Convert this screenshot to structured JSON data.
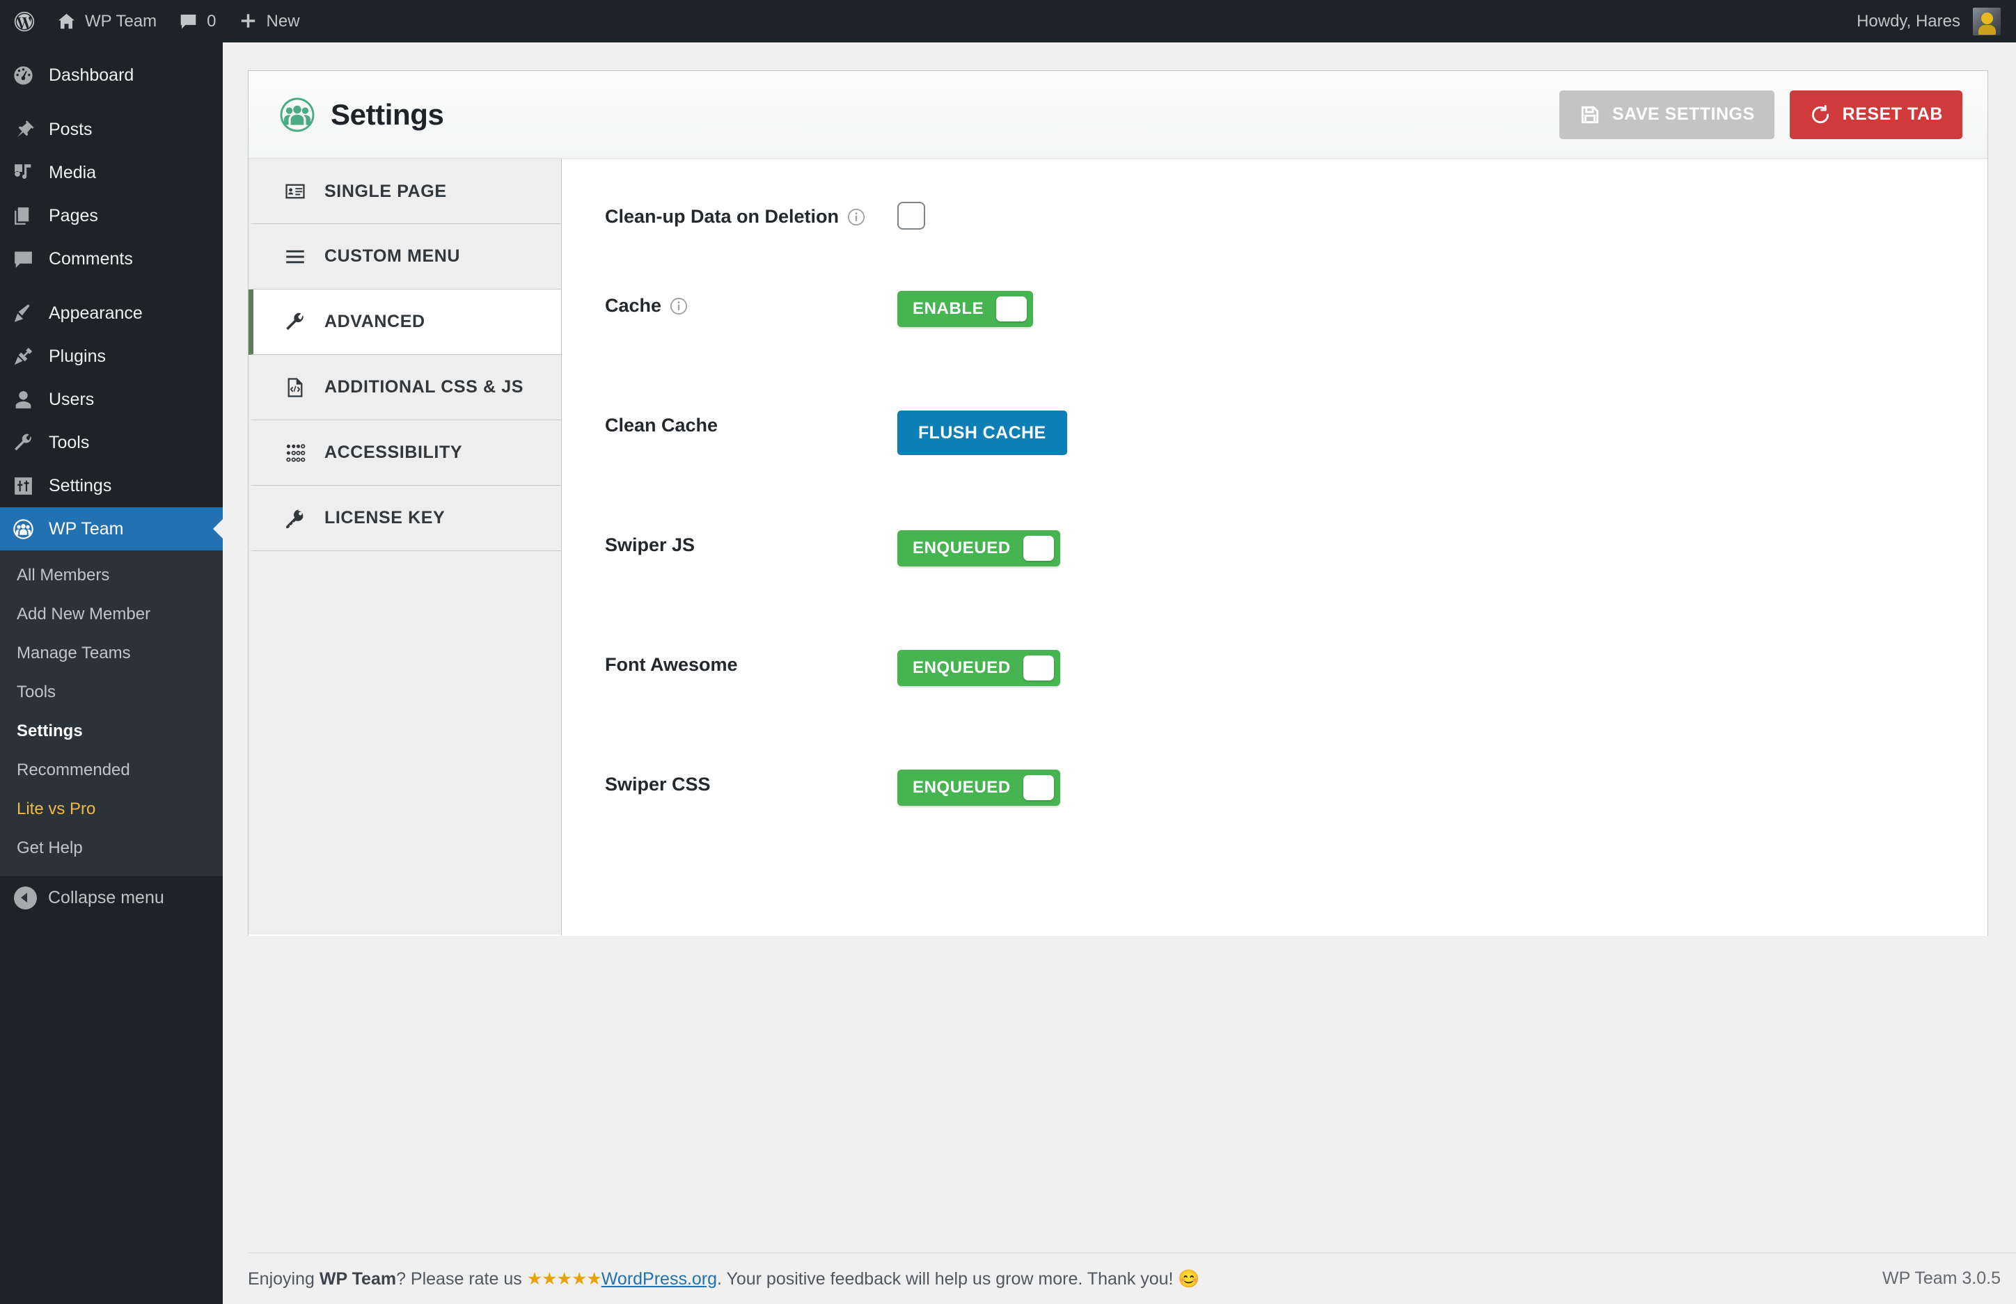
{
  "adminbar": {
    "wp_logo": "wordpress-logo-icon",
    "site_name": "WP Team",
    "comments_count": "0",
    "new_label": "New",
    "howdy": "Howdy, Hares"
  },
  "sidebar": {
    "items": [
      {
        "label": "Dashboard",
        "icon": "dashboard-icon",
        "current": false
      },
      {
        "label": "Posts",
        "icon": "pin-icon",
        "current": false
      },
      {
        "label": "Media",
        "icon": "media-icon",
        "current": false
      },
      {
        "label": "Pages",
        "icon": "pages-icon",
        "current": false
      },
      {
        "label": "Comments",
        "icon": "comments-icon",
        "current": false
      },
      {
        "label": "Appearance",
        "icon": "brush-icon",
        "current": false
      },
      {
        "label": "Plugins",
        "icon": "plug-icon",
        "current": false
      },
      {
        "label": "Users",
        "icon": "user-icon",
        "current": false
      },
      {
        "label": "Tools",
        "icon": "wrench-icon",
        "current": false
      },
      {
        "label": "Settings",
        "icon": "sliders-icon",
        "current": false
      },
      {
        "label": "WP Team",
        "icon": "team-icon",
        "current": true
      }
    ],
    "submenu": [
      {
        "label": "All Members",
        "state": "normal"
      },
      {
        "label": "Add New Member",
        "state": "normal"
      },
      {
        "label": "Manage Teams",
        "state": "normal"
      },
      {
        "label": "Tools",
        "state": "normal"
      },
      {
        "label": "Settings",
        "state": "current"
      },
      {
        "label": "Recommended",
        "state": "normal"
      },
      {
        "label": "Lite vs Pro",
        "state": "highlight"
      },
      {
        "label": "Get Help",
        "state": "normal"
      }
    ],
    "collapse_label": "Collapse menu"
  },
  "header": {
    "title": "Settings",
    "brand_icon": "wp-team-group-icon",
    "save_label": "SAVE SETTINGS",
    "save_icon": "floppy-disk-icon",
    "reset_label": "RESET TAB",
    "reset_icon": "refresh-icon"
  },
  "tabs": [
    {
      "label": "SINGLE PAGE",
      "icon": "id-card-icon",
      "active": false
    },
    {
      "label": "CUSTOM MENU",
      "icon": "hamburger-menu-icon",
      "active": false
    },
    {
      "label": "ADVANCED",
      "icon": "wrench-icon",
      "active": true
    },
    {
      "label": "ADDITIONAL CSS & JS",
      "icon": "code-file-icon",
      "active": false
    },
    {
      "label": "ACCESSIBILITY",
      "icon": "braille-dots-icon",
      "active": false
    },
    {
      "label": "LICENSE KEY",
      "icon": "key-icon",
      "active": false
    }
  ],
  "fields": [
    {
      "label": "Clean-up Data on Deletion",
      "has_info": true,
      "control": "checkbox",
      "checked": false
    },
    {
      "label": "Cache",
      "has_info": true,
      "control": "toggle",
      "value": "ENABLE"
    },
    {
      "label": "Clean Cache",
      "has_info": false,
      "control": "button",
      "value": "FLUSH CACHE"
    },
    {
      "label": "Swiper JS",
      "has_info": false,
      "control": "toggle",
      "value": "ENQUEUED"
    },
    {
      "label": "Font Awesome",
      "has_info": false,
      "control": "toggle",
      "value": "ENQUEUED"
    },
    {
      "label": "Swiper CSS",
      "has_info": false,
      "control": "toggle",
      "value": "ENQUEUED"
    }
  ],
  "footer": {
    "prefix": "Enjoying ",
    "brand": "WP Team",
    "mid": "? Please rate us ",
    "stars": "★★★★★",
    "link": "WordPress.org",
    "suffix": ". Your positive feedback will help us grow more. Thank you! 😊",
    "version": "WP Team 3.0.5"
  },
  "colors": {
    "accent_blue": "#2271b1",
    "toggle_green": "#46b450",
    "brand_green": "#4aab84",
    "reset_red": "#cf3a3a",
    "flush_blue": "#0c80b6",
    "highlight_yellow": "#f0b849"
  }
}
